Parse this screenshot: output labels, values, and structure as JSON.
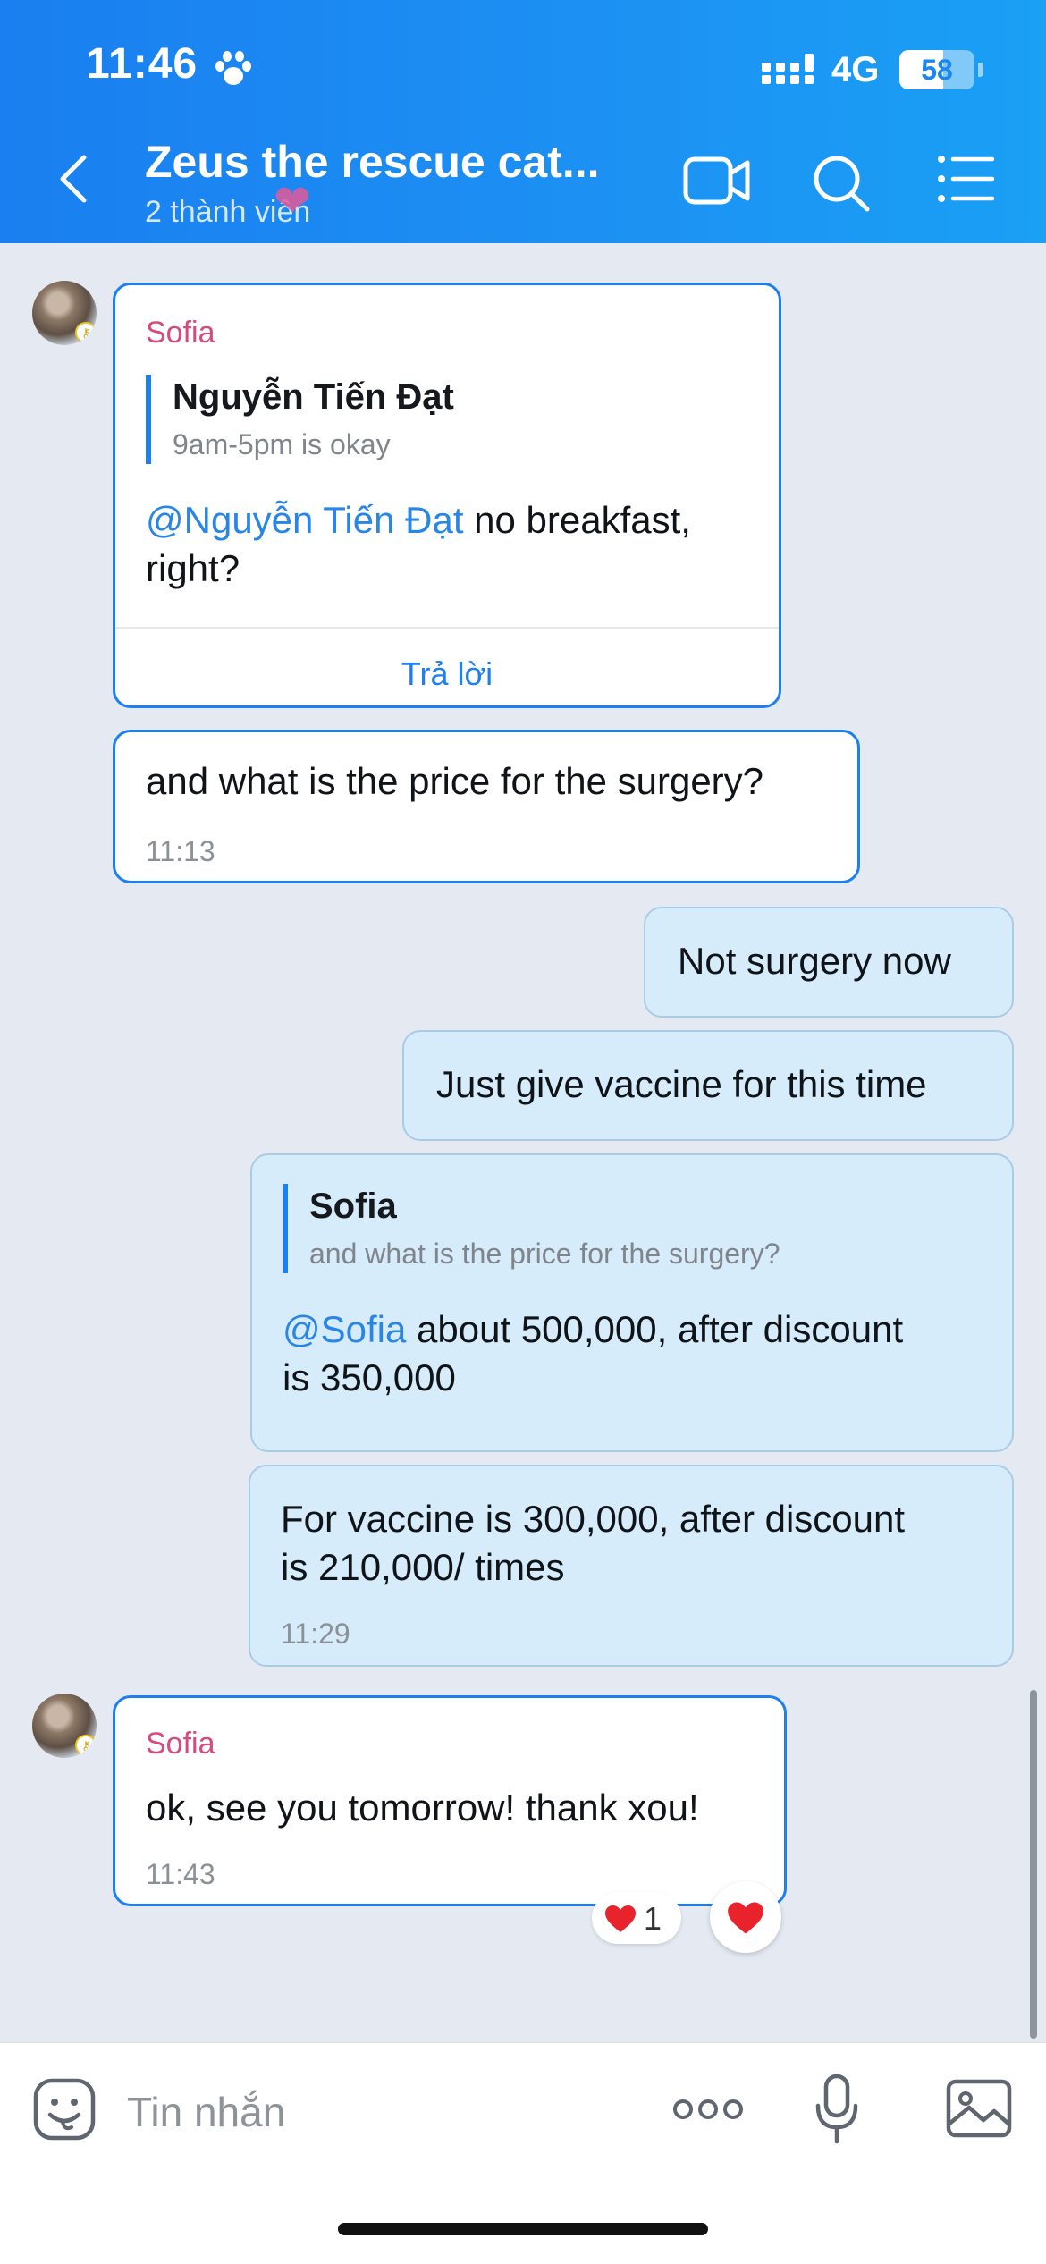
{
  "status_bar": {
    "time": "11:46",
    "network": "4G",
    "battery": "58",
    "battery_level": 0.58
  },
  "header": {
    "title": "Zeus the rescue cat...",
    "subtitle": "2 thành viên",
    "accent": "#1a86f1"
  },
  "messages": [
    {
      "id": "m1",
      "direction": "incoming",
      "sender": "Sofia",
      "quote": {
        "name": "Nguyễn Tiến Đạt",
        "text": "9am-5pm is okay"
      },
      "mention": "@Nguyễn Tiến Đạt",
      "text_line1": " no breakfast,",
      "text_line2": "right?",
      "reply_label": "Trả lời"
    },
    {
      "id": "m2",
      "direction": "incoming",
      "text": "and what is the price for the surgery?",
      "time": "11:13"
    },
    {
      "id": "m3",
      "direction": "outgoing",
      "text": "Not surgery now"
    },
    {
      "id": "m4",
      "direction": "outgoing",
      "text": "Just give vaccine for this time"
    },
    {
      "id": "m5",
      "direction": "outgoing",
      "quote": {
        "name": "Sofia",
        "text": "and what is the price for the surgery?"
      },
      "mention": "@Sofia",
      "text_line1": " about 500,000, after discount",
      "text_line2": "is 350,000"
    },
    {
      "id": "m6",
      "direction": "outgoing",
      "text_line1": "For vaccine is 300,000, after discount",
      "text_line2": "is 210,000/ times",
      "time": "11:29"
    },
    {
      "id": "m7",
      "direction": "incoming",
      "sender": "Sofia",
      "text": "ok, see you tomorrow! thank xou!",
      "time": "11:43",
      "reaction_count": "1"
    }
  ],
  "input": {
    "placeholder": "Tin nhắn"
  },
  "icons": [
    "paw-icon",
    "signal-icon",
    "back-icon",
    "video-call-icon",
    "search-icon",
    "menu-list-icon",
    "sticker-icon",
    "more-icon",
    "mic-icon",
    "image-icon",
    "heart-icon"
  ]
}
